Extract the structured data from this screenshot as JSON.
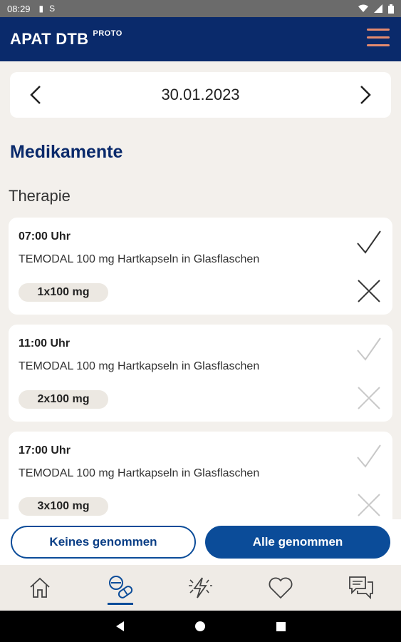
{
  "status_bar": {
    "time": "08:29",
    "icons": [
      "lock-icon",
      "sync-icon"
    ],
    "right_icons": [
      "wifi-icon",
      "signal-icon",
      "battery-icon"
    ]
  },
  "app_bar": {
    "title": "APAT DTB",
    "badge": "PROTO",
    "menu_icon": "hamburger-menu-icon"
  },
  "date_selector": {
    "date": "30.01.2023",
    "prev_icon": "chevron-left-icon",
    "next_icon": "chevron-right-icon"
  },
  "section_title": "Medikamente",
  "group_title": "Therapie",
  "medications": [
    {
      "time": "07:00 Uhr",
      "name": "TEMODAL 100 mg Hartkapseln in Glasflaschen",
      "dose": "1x100 mg",
      "state": "active"
    },
    {
      "time": "11:00 Uhr",
      "name": "TEMODAL 100 mg Hartkapseln in Glasflaschen",
      "dose": "2x100 mg",
      "state": "inactive"
    },
    {
      "time": "17:00 Uhr",
      "name": "TEMODAL 100 mg Hartkapseln in Glasflaschen",
      "dose": "3x100 mg",
      "state": "inactive"
    }
  ],
  "actions": {
    "none_taken": "Keines genommen",
    "all_taken": "Alle genommen"
  },
  "bottom_nav": [
    {
      "icon": "home-icon",
      "active": false
    },
    {
      "icon": "medication-icon",
      "active": true
    },
    {
      "icon": "symptoms-lightning-icon",
      "active": false
    },
    {
      "icon": "heart-icon",
      "active": false
    },
    {
      "icon": "chat-icon",
      "active": false
    }
  ],
  "colors": {
    "primary": "#0a2a6b",
    "button": "#0b4c99",
    "accent_menu": "#e58a6e",
    "background": "#f3f0ec"
  }
}
